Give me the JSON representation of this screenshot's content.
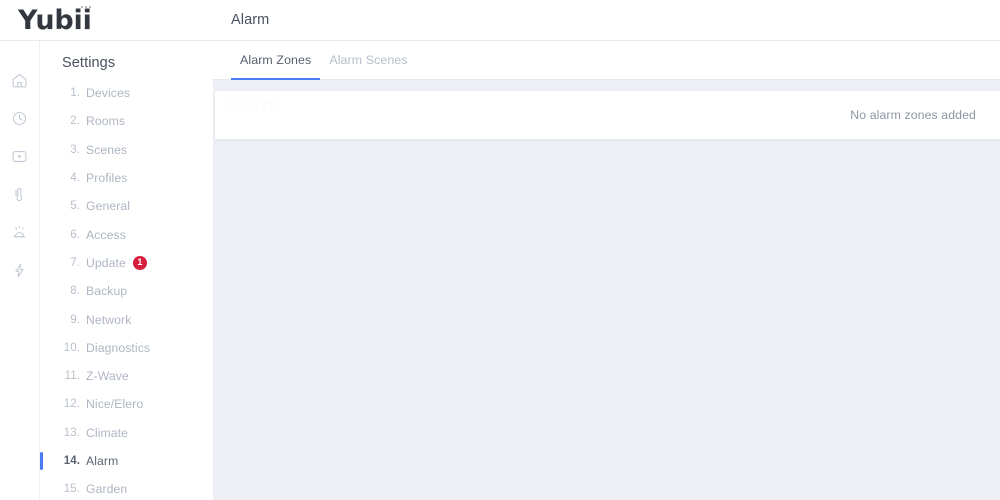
{
  "brand": {
    "name": "Yubii",
    "dots_icon": "three-dots-icon"
  },
  "sidebar_rail": {
    "items": [
      {
        "name": "home-icon",
        "label": "Home"
      },
      {
        "name": "history-clock-icon",
        "label": "History"
      },
      {
        "name": "scenes-play-icon",
        "label": "Scenes"
      },
      {
        "name": "climate-thermometer-icon",
        "label": "Climate"
      },
      {
        "name": "alarm-siren-icon",
        "label": "Alarm"
      },
      {
        "name": "energy-bolt-icon",
        "label": "Energy"
      }
    ]
  },
  "settings": {
    "title": "Settings",
    "items": [
      {
        "num": "1.",
        "label": "Devices",
        "active": false
      },
      {
        "num": "2.",
        "label": "Rooms",
        "active": false
      },
      {
        "num": "3.",
        "label": "Scenes",
        "active": false
      },
      {
        "num": "4.",
        "label": "Profiles",
        "active": false
      },
      {
        "num": "5.",
        "label": "General",
        "active": false
      },
      {
        "num": "6.",
        "label": "Access",
        "active": false
      },
      {
        "num": "7.",
        "label": "Update",
        "active": false,
        "badge": "1"
      },
      {
        "num": "8.",
        "label": "Backup",
        "active": false
      },
      {
        "num": "9.",
        "label": "Network",
        "active": false
      },
      {
        "num": "10.",
        "label": "Diagnostics",
        "active": false
      },
      {
        "num": "11.",
        "label": "Z-Wave",
        "active": false
      },
      {
        "num": "12.",
        "label": "Nice/Elero",
        "active": false
      },
      {
        "num": "13.",
        "label": "Climate",
        "active": false
      },
      {
        "num": "14.",
        "label": "Alarm",
        "active": true
      },
      {
        "num": "15.",
        "label": "Garden",
        "active": false
      }
    ]
  },
  "header": {
    "title": "Alarm"
  },
  "tabs": [
    {
      "label": "Alarm Zones",
      "active": true
    },
    {
      "label": "Alarm Scenes",
      "active": false
    }
  ],
  "zones_card": {
    "empty_message": "No alarm zones added",
    "watermark": "Alarm"
  },
  "colors": {
    "accent_blue": "#4c7cf3",
    "badge_red": "#d81e3f",
    "panel_white": "#ffffff",
    "content_bg": "#eceff4",
    "text_dark": "#4a5260",
    "text_muted": "#aeb6c2"
  }
}
